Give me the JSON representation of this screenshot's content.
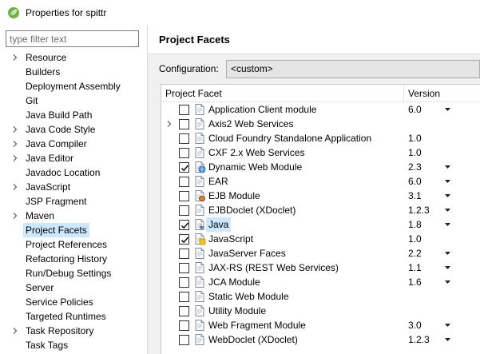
{
  "window": {
    "title": "Properties for spittr",
    "icon": "spring-leaf-icon",
    "accent": "#6db33f"
  },
  "filter": {
    "placeholder": "type filter text",
    "value": ""
  },
  "nav": [
    {
      "label": "Resource",
      "expandable": true
    },
    {
      "label": "Builders",
      "expandable": false
    },
    {
      "label": "Deployment Assembly",
      "expandable": false
    },
    {
      "label": "Git",
      "expandable": false
    },
    {
      "label": "Java Build Path",
      "expandable": false
    },
    {
      "label": "Java Code Style",
      "expandable": true
    },
    {
      "label": "Java Compiler",
      "expandable": true
    },
    {
      "label": "Java Editor",
      "expandable": true
    },
    {
      "label": "Javadoc Location",
      "expandable": false
    },
    {
      "label": "JavaScript",
      "expandable": true
    },
    {
      "label": "JSP Fragment",
      "expandable": false
    },
    {
      "label": "Maven",
      "expandable": true
    },
    {
      "label": "Project Facets",
      "expandable": false,
      "selected": true
    },
    {
      "label": "Project References",
      "expandable": false
    },
    {
      "label": "Refactoring History",
      "expandable": false
    },
    {
      "label": "Run/Debug Settings",
      "expandable": false
    },
    {
      "label": "Server",
      "expandable": false
    },
    {
      "label": "Service Policies",
      "expandable": false
    },
    {
      "label": "Targeted Runtimes",
      "expandable": false
    },
    {
      "label": "Task Repository",
      "expandable": true
    },
    {
      "label": "Task Tags",
      "expandable": false
    }
  ],
  "page": {
    "title": "Project Facets",
    "configuration_label": "Configuration:",
    "configuration_value": "<custom>"
  },
  "table": {
    "col_facet": "Project Facet",
    "col_version": "Version",
    "rows": [
      {
        "name": "Application Client module",
        "version": "6.0",
        "checked": false,
        "dropdown": true,
        "icon": "module-page-icon",
        "expandable": false
      },
      {
        "name": "Axis2 Web Services",
        "version": "",
        "checked": false,
        "dropdown": false,
        "icon": "module-page-icon",
        "expandable": true
      },
      {
        "name": "Cloud Foundry Standalone Application",
        "version": "1.0",
        "checked": false,
        "dropdown": false,
        "icon": "module-page-icon",
        "expandable": false
      },
      {
        "name": "CXF 2.x Web Services",
        "version": "1.0",
        "checked": false,
        "dropdown": false,
        "icon": "module-page-icon",
        "expandable": false
      },
      {
        "name": "Dynamic Web Module",
        "version": "2.3",
        "checked": true,
        "dropdown": true,
        "icon": "globe-page-icon",
        "expandable": false
      },
      {
        "name": "EAR",
        "version": "6.0",
        "checked": false,
        "dropdown": true,
        "icon": "module-page-icon",
        "expandable": false
      },
      {
        "name": "EJB Module",
        "version": "3.1",
        "checked": false,
        "dropdown": true,
        "icon": "bean-page-icon",
        "expandable": false
      },
      {
        "name": "EJBDoclet (XDoclet)",
        "version": "1.2.3",
        "checked": false,
        "dropdown": true,
        "icon": "module-page-icon",
        "expandable": false
      },
      {
        "name": "Java",
        "version": "1.8",
        "checked": true,
        "dropdown": true,
        "icon": "java-page-icon",
        "expandable": false,
        "selected": true
      },
      {
        "name": "JavaScript",
        "version": "1.0",
        "checked": true,
        "dropdown": false,
        "icon": "javascript-page-icon",
        "expandable": false
      },
      {
        "name": "JavaServer Faces",
        "version": "2.2",
        "checked": false,
        "dropdown": true,
        "icon": "module-page-icon",
        "expandable": false
      },
      {
        "name": "JAX-RS (REST Web Services)",
        "version": "1.1",
        "checked": false,
        "dropdown": true,
        "icon": "module-page-icon",
        "expandable": false
      },
      {
        "name": "JCA Module",
        "version": "1.6",
        "checked": false,
        "dropdown": true,
        "icon": "module-page-icon",
        "expandable": false
      },
      {
        "name": "Static Web Module",
        "version": "",
        "checked": false,
        "dropdown": false,
        "icon": "module-page-icon",
        "expandable": false
      },
      {
        "name": "Utility Module",
        "version": "",
        "checked": false,
        "dropdown": false,
        "icon": "module-page-icon",
        "expandable": false
      },
      {
        "name": "Web Fragment Module",
        "version": "3.0",
        "checked": false,
        "dropdown": true,
        "icon": "module-page-icon",
        "expandable": false
      },
      {
        "name": "WebDoclet (XDoclet)",
        "version": "1.2.3",
        "checked": false,
        "dropdown": true,
        "icon": "module-page-icon",
        "expandable": false
      }
    ]
  }
}
